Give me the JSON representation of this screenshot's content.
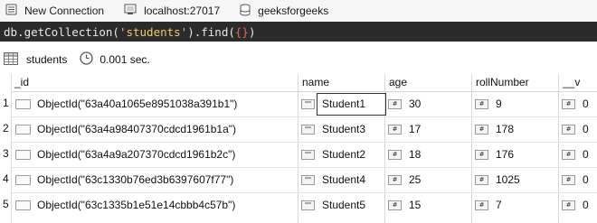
{
  "breadcrumbs": [
    {
      "label": "New Connection",
      "icon": "connection-icon"
    },
    {
      "label": "localhost:27017",
      "icon": "server-icon"
    },
    {
      "label": "geeksforgeeks",
      "icon": "database-icon"
    }
  ],
  "query": {
    "prefix": "db.getCollection(",
    "collection": "'students'",
    "middle": ").find(",
    "arg": "{}",
    "suffix": ")"
  },
  "results": {
    "collection": "students",
    "time": "0.001 sec."
  },
  "table": {
    "columns": [
      "_id",
      "name",
      "age",
      "rollNumber",
      "__v"
    ],
    "rows": [
      {
        "num": "1",
        "id": "ObjectId(\"63a40a1065e8951038a391b1\")",
        "name": "Student1",
        "age": "30",
        "roll": "9",
        "v": "0"
      },
      {
        "num": "2",
        "id": "ObjectId(\"63a4a98407370cdcd1961b1a\")",
        "name": "Student3",
        "age": "17",
        "roll": "178",
        "v": "0"
      },
      {
        "num": "3",
        "id": "ObjectId(\"63a4a9a207370cdcd1961b2c\")",
        "name": "Student2",
        "age": "18",
        "roll": "176",
        "v": "0"
      },
      {
        "num": "4",
        "id": "ObjectId(\"63c1330b76ed3b6397607f77\")",
        "name": "Student4",
        "age": "25",
        "roll": "1025",
        "v": "0"
      },
      {
        "num": "5",
        "id": "ObjectId(\"63c1335b1e51e14cbbb4c57b\")",
        "name": "Student5",
        "age": "15",
        "roll": "7",
        "v": "0"
      }
    ]
  },
  "type_icons": {
    "string": "\"\"",
    "number": "#"
  }
}
